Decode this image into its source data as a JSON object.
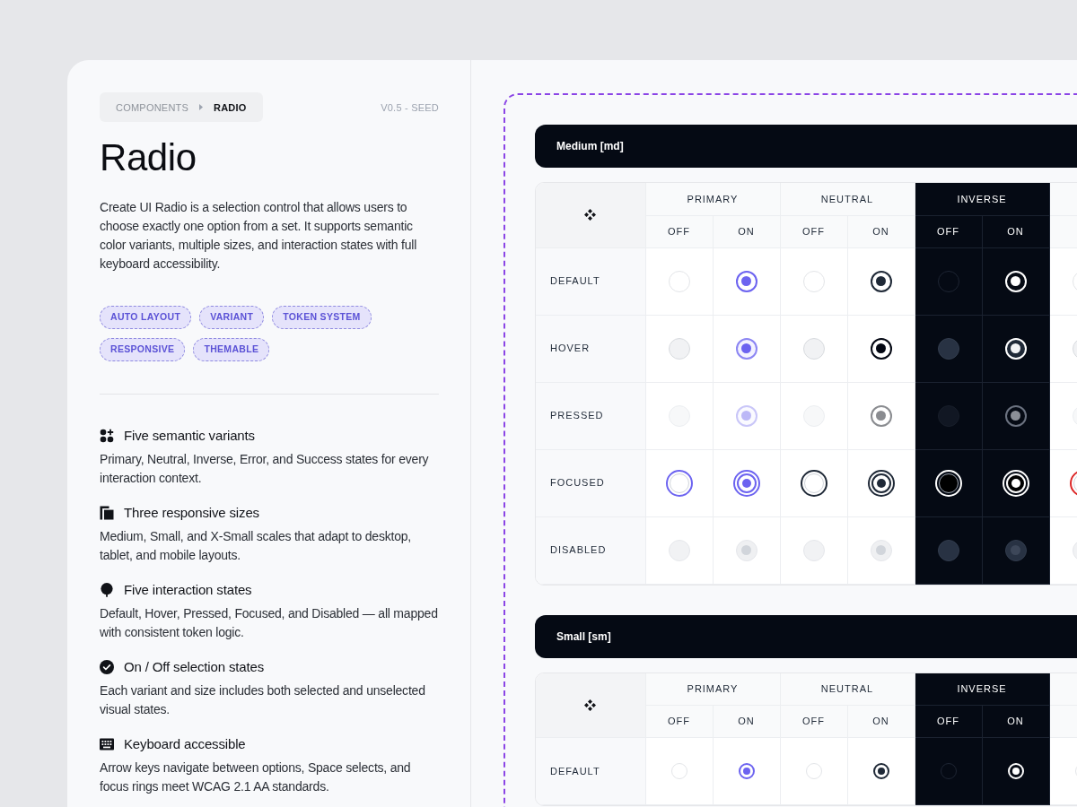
{
  "breadcrumb": [
    {
      "label": "COMPONENTS",
      "current": false
    },
    {
      "label": "RADIO",
      "current": true
    }
  ],
  "version": "V0.5 - SEED",
  "title": "Radio",
  "description": "Create UI Radio is a selection control that allows users to choose exactly one option from a set. It supports semantic color variants, multiple sizes, and interaction states with full keyboard accessibility.",
  "tags": [
    "AUTO LAYOUT",
    "VARIANT",
    "TOKEN SYSTEM",
    "RESPONSIVE",
    "THEMABLE"
  ],
  "features": [
    {
      "title": "Five semantic variants",
      "text": "Primary, Neutral, Inverse, Error, and Success states for every interaction context."
    },
    {
      "title": "Three responsive sizes",
      "text": "Medium, Small, and X-Small scales that adapt to desktop, tablet, and mobile layouts."
    },
    {
      "title": "Five interaction states",
      "text": "Default, Hover, Pressed, Focused, and Disabled — all mapped with consistent token logic."
    },
    {
      "title": "On / Off selection states",
      "text": "Each variant and size includes both selected and unselected visual states."
    },
    {
      "title": "Keyboard accessible",
      "text": "Arrow keys navigate between options, Space selects, and focus rings meet WCAG 2.1 AA standards."
    }
  ],
  "sections": [
    {
      "title": "Medium [md]",
      "kind": "md",
      "variants": [
        {
          "label": "PRIMARY",
          "kind": "primary",
          "columns": [
            {
              "label": "OFF",
              "on": false
            },
            {
              "label": "ON",
              "on": true
            }
          ]
        },
        {
          "label": "NEUTRAL",
          "kind": "neutral",
          "columns": [
            {
              "label": "OFF",
              "on": false
            },
            {
              "label": "ON",
              "on": true
            }
          ]
        },
        {
          "label": "INVERSE",
          "kind": "inverse",
          "columns": [
            {
              "label": "OFF",
              "on": false
            },
            {
              "label": "ON",
              "on": true
            }
          ]
        },
        {
          "kind": "error",
          "columns": [
            {
              "on": false
            }
          ]
        }
      ],
      "rows": [
        {
          "label": "DEFAULT",
          "kind": "default"
        },
        {
          "label": "HOVER",
          "kind": "hover"
        },
        {
          "label": "PRESSED",
          "kind": "pressed"
        },
        {
          "label": "FOCUSED",
          "kind": "focused"
        },
        {
          "label": "DISABLED",
          "kind": "disabled"
        }
      ]
    },
    {
      "title": "Small [sm]",
      "kind": "sm",
      "variants": [
        {
          "label": "PRIMARY",
          "kind": "primary",
          "columns": [
            {
              "label": "OFF",
              "on": false
            },
            {
              "label": "ON",
              "on": true
            }
          ]
        },
        {
          "label": "NEUTRAL",
          "kind": "neutral",
          "columns": [
            {
              "label": "OFF",
              "on": false
            },
            {
              "label": "ON",
              "on": true
            }
          ]
        },
        {
          "label": "INVERSE",
          "kind": "inverse",
          "columns": [
            {
              "label": "OFF",
              "on": false
            },
            {
              "label": "ON",
              "on": true
            }
          ]
        },
        {
          "kind": "error",
          "columns": [
            {
              "on": false
            }
          ]
        }
      ],
      "rows": [
        {
          "label": "DEFAULT",
          "kind": "default"
        }
      ]
    }
  ]
}
